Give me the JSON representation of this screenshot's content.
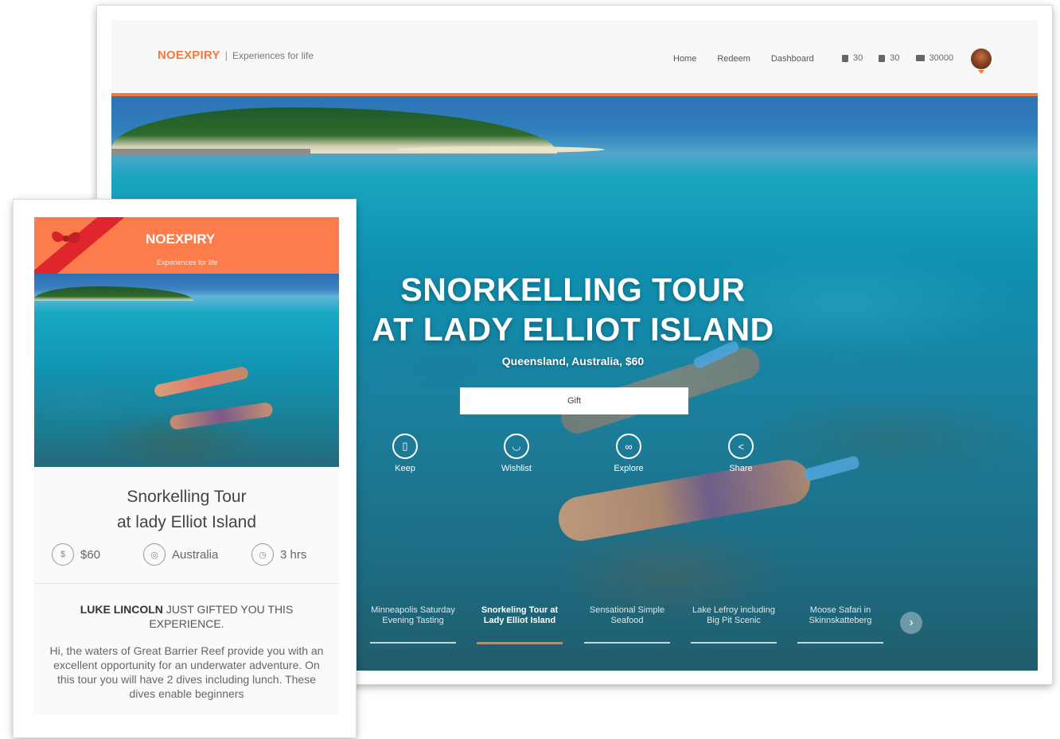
{
  "desktop": {
    "logo": {
      "brand": "NOEXPIRY",
      "separator": "|",
      "tagline": "Experiences for life"
    },
    "nav": [
      "Home",
      "Redeem",
      "Dashboard"
    ],
    "stats": [
      {
        "icon": "bookmark-icon",
        "value": "30"
      },
      {
        "icon": "cup-icon",
        "value": "30"
      },
      {
        "icon": "wallet-icon",
        "value": "30000"
      }
    ],
    "hero": {
      "title_line1": "SNORKELLING TOUR",
      "title_line2": "AT LADY ELLIOT ISLAND",
      "subtitle": "Queensland, Australia, $60",
      "gift_label": "Gift",
      "actions": [
        {
          "label": "Keep",
          "icon": "bookmark-icon"
        },
        {
          "label": "Wishlist",
          "icon": "cup-icon"
        },
        {
          "label": "Explore",
          "icon": "binoculars-icon"
        },
        {
          "label": "Share",
          "icon": "share-icon"
        }
      ]
    },
    "carousel": [
      {
        "line1": "Minneapolis Saturday",
        "line2": "Evening Tasting",
        "active": false
      },
      {
        "line1": "Snorkeling Tour at",
        "line2": "Lady Elliot Island",
        "active": true
      },
      {
        "line1": "Sensational Simple",
        "line2": "Seafood",
        "active": false
      },
      {
        "line1": "Lake Lefroy including",
        "line2": "Big Pit Scenic",
        "active": false
      },
      {
        "line1": "Moose Safari in",
        "line2": "Skinnskatteberg",
        "active": false
      }
    ]
  },
  "card": {
    "logo": {
      "brand": "NOEXPIRY",
      "tagline": "Experiences for life"
    },
    "title_line1": "Snorkelling Tour",
    "title_line2": "at lady Elliot Island",
    "meta": [
      {
        "icon": "price-tag-icon",
        "label": "$60"
      },
      {
        "icon": "location-icon",
        "label": "Australia"
      },
      {
        "icon": "clock-icon",
        "label": "3 hrs"
      }
    ],
    "gifted_name": "LUKE LINCOLN",
    "gifted_text": "JUST GIFTED YOU THIS EXPERIENCE.",
    "message": "Hi, the waters of Great Barrier Reef provide you with an excellent opportunity for an underwater adventure. On this tour you will have 2 dives including lunch. These dives enable beginners"
  },
  "colors": {
    "accent": "#f07a3c",
    "card_header": "#fc7d4b",
    "ribbon": "#e0262d"
  }
}
